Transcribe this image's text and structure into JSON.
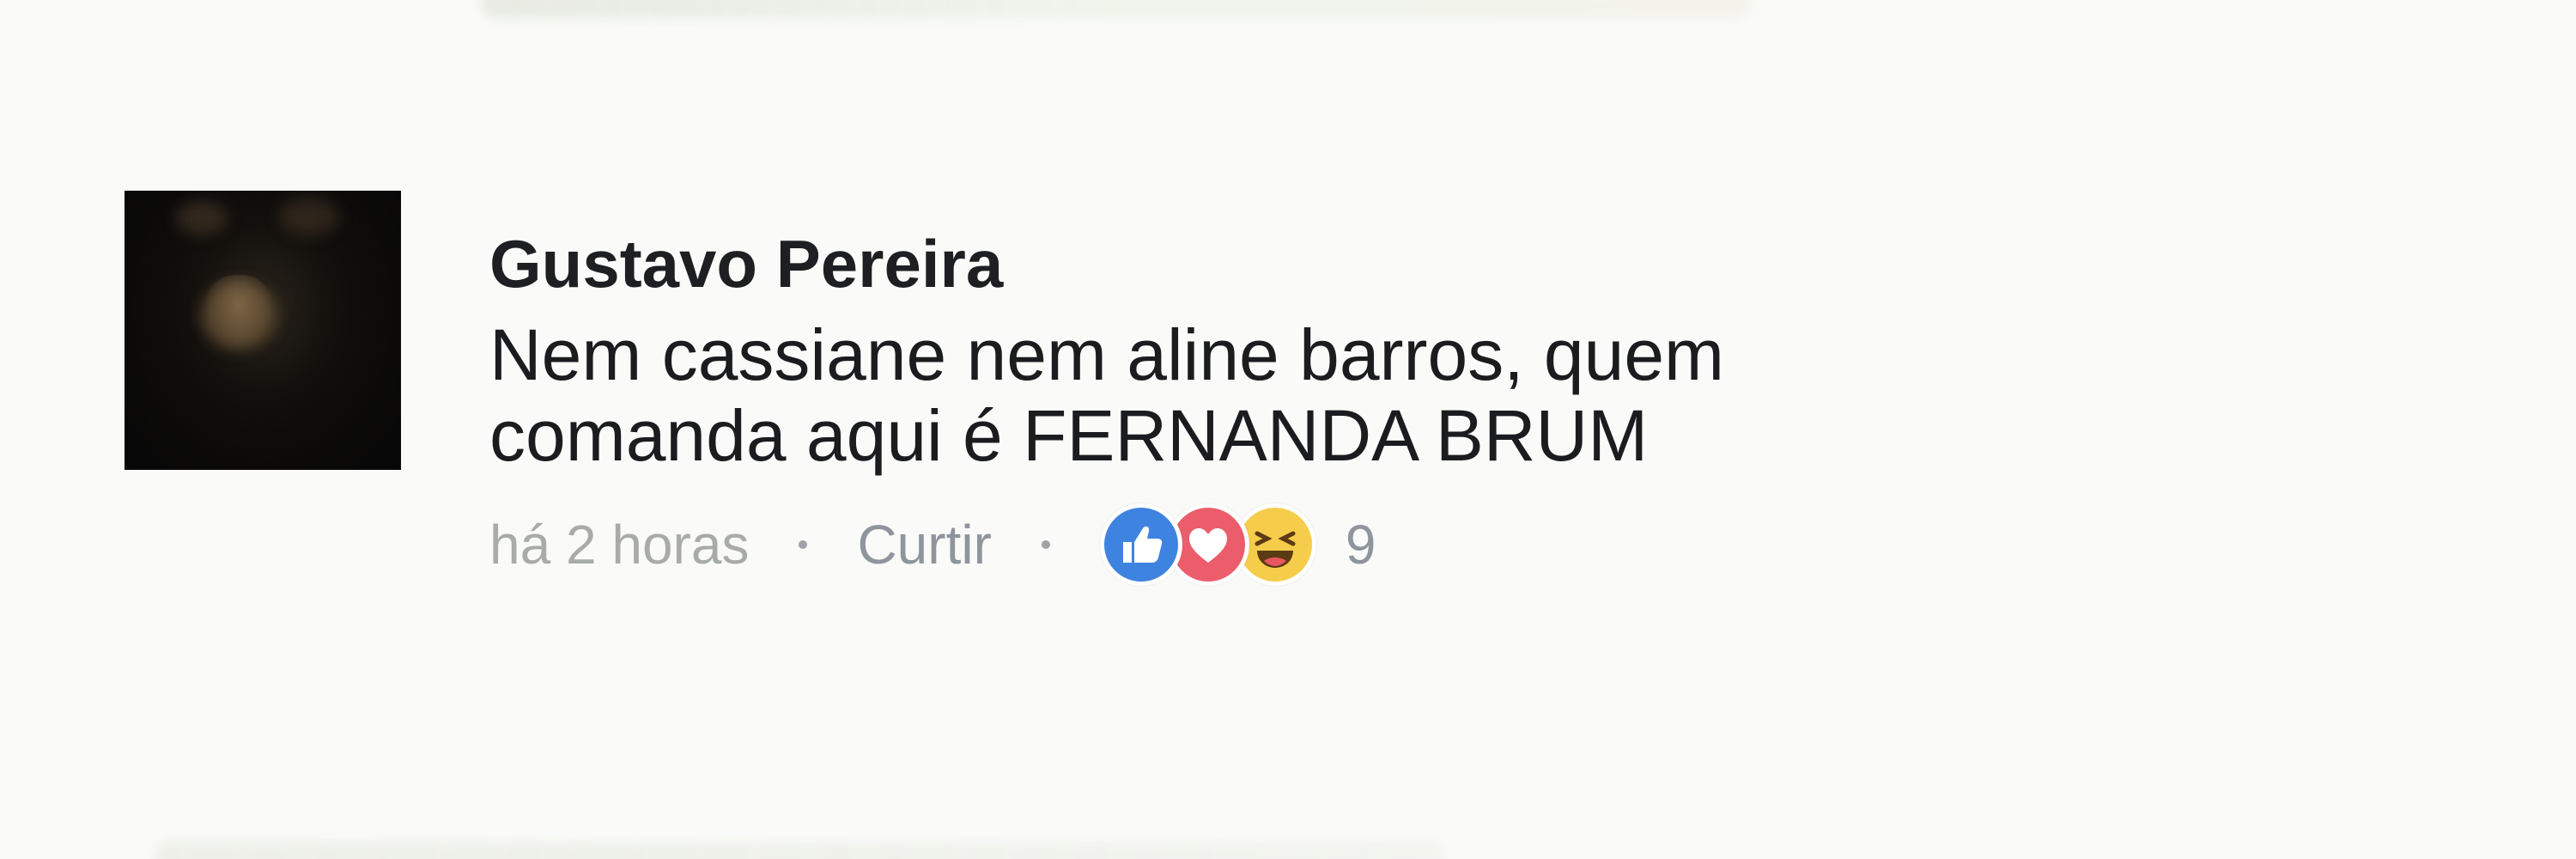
{
  "comment": {
    "author": "Gustavo Pereira",
    "text_lines": [
      "Nem cassiane nem aline barros, quem",
      "comanda aqui é FERNANDA BRUM"
    ],
    "timestamp": "há 2 horas",
    "like_label": "Curtir",
    "reactions": {
      "icons": [
        "like-icon",
        "love-icon",
        "haha-icon"
      ],
      "count": "9"
    }
  },
  "colors": {
    "like": "#3f83e0",
    "love": "#ec5d6b",
    "haha": "#f6cd4a"
  }
}
